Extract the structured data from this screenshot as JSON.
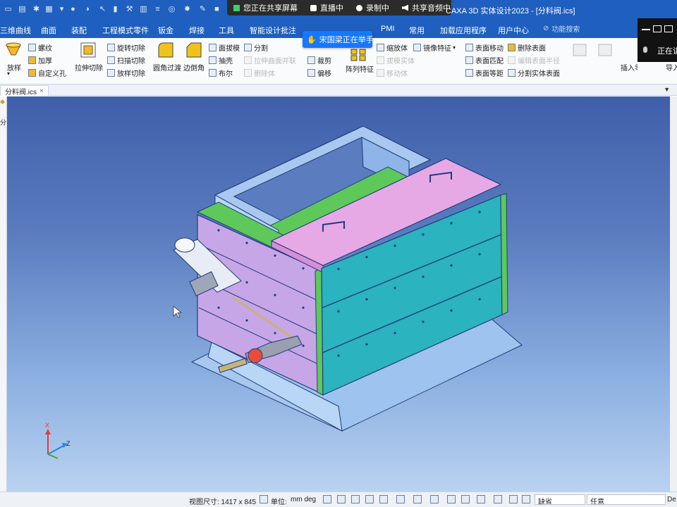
{
  "titlebar": {
    "share_screen": "您正在共享屏幕",
    "live": "直播中",
    "recording": "录制中",
    "share_audio": "共享音频中",
    "app_title": "CAXA 3D 实体设计2023 - [分料阀.ics]",
    "speaking": "正在讲"
  },
  "menu": {
    "tabs": [
      "三维曲线",
      "曲面",
      "装配",
      "工程模式零件",
      "钣金",
      "焊接",
      "工具",
      "智能设计批注",
      "PMI",
      "常用",
      "加载应用程序",
      "用户中心"
    ],
    "search_placeholder": "功能搜索"
  },
  "hand_badge": "宋国梁正在举手",
  "ribbon": {
    "loft": "放样",
    "thread": "螺纹",
    "thicken": "加厚",
    "custom_hole": "自定义孔",
    "extrude_cut": "拉伸切除",
    "revolve_cut": "旋转切除",
    "sweep_cut": "扫描切除",
    "loft_cut": "放样切除",
    "fillet": "圆角过渡",
    "chamfer": "边倒角",
    "face_draft": "面拔模",
    "shell": "抽壳",
    "boolean": "布尔",
    "split": "分割",
    "param_face_off": "拉伸曲面并联",
    "delete_body": "删除体",
    "trim": "裁剪",
    "move": "偏移",
    "array_feature": "阵列特征",
    "scale_body": "缩放体",
    "mirror_feature": "镜像特征",
    "face_move": "表面移动",
    "delete_face": "删除表面",
    "face_match": "表面匹配",
    "face_equidistant": "表面等距",
    "split_solid_face": "分割实体表面",
    "insert_part": "插入零件/装配",
    "import": "导入"
  },
  "document": {
    "tab": "分料阀.ics"
  },
  "left_strip": {
    "label": "分"
  },
  "axes": {
    "x": "X",
    "z": "Z"
  },
  "statusbar": {
    "view_size_label": "视图尺寸: 1417 x 845",
    "unit_label": "单位:",
    "unit_value": "mm deg",
    "field_blank": "缺省",
    "selector": "任意",
    "right": "De"
  },
  "colors": {
    "accent": "#1e5fbf",
    "model_lilac": "#c7a6e8",
    "model_teal": "#2bb3c0",
    "model_frame": "#a8c8f0",
    "model_green": "#5ec95a",
    "model_pink": "#e7a8e6"
  }
}
